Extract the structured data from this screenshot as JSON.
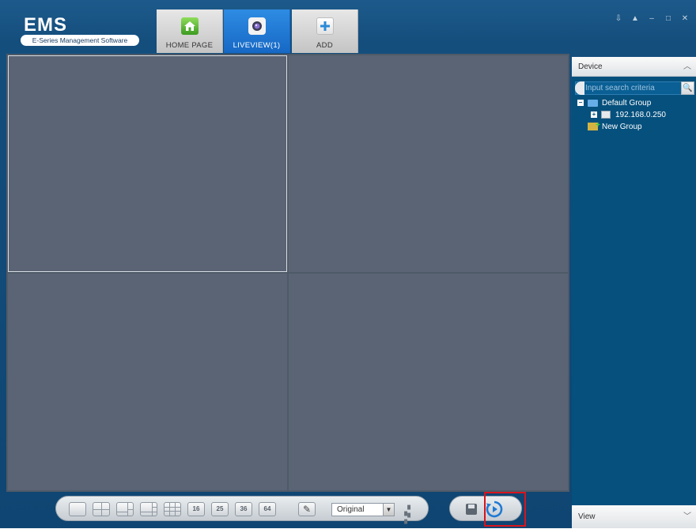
{
  "app": {
    "logo_title": "EMS",
    "logo_subtitle": "E-Series Management Software"
  },
  "tabs": [
    {
      "label": "HOME PAGE",
      "icon": "home-icon",
      "active": false
    },
    {
      "label": "LIVEVIEW(1)",
      "icon": "camera-icon",
      "active": true
    },
    {
      "label": "ADD",
      "icon": "plus-icon",
      "active": false
    }
  ],
  "window_controls": [
    "download-icon",
    "lock-icon",
    "minimize-icon",
    "maximize-icon",
    "close-icon"
  ],
  "toolbar": {
    "layouts": [
      "1",
      "4",
      "6",
      "8",
      "9",
      "16",
      "25",
      "36",
      "64"
    ],
    "ratio_value": "Original",
    "edit_icon": "edit-icon",
    "fullscreen_icon": "fullscreen-icon",
    "save_icon": "save-icon",
    "cycle_icon": "cycle-play-icon"
  },
  "device_panel": {
    "header": "Device",
    "search_placeholder": "Input search criteria",
    "tree": {
      "group": "Default Group",
      "device": "192.168.0.250",
      "new_group": "New Group"
    },
    "footer": "View"
  },
  "colors": {
    "background": "#0f4572",
    "active_tab": "#1f7ad3",
    "video_cell": "#5a6474",
    "highlight": "#d8141c"
  }
}
